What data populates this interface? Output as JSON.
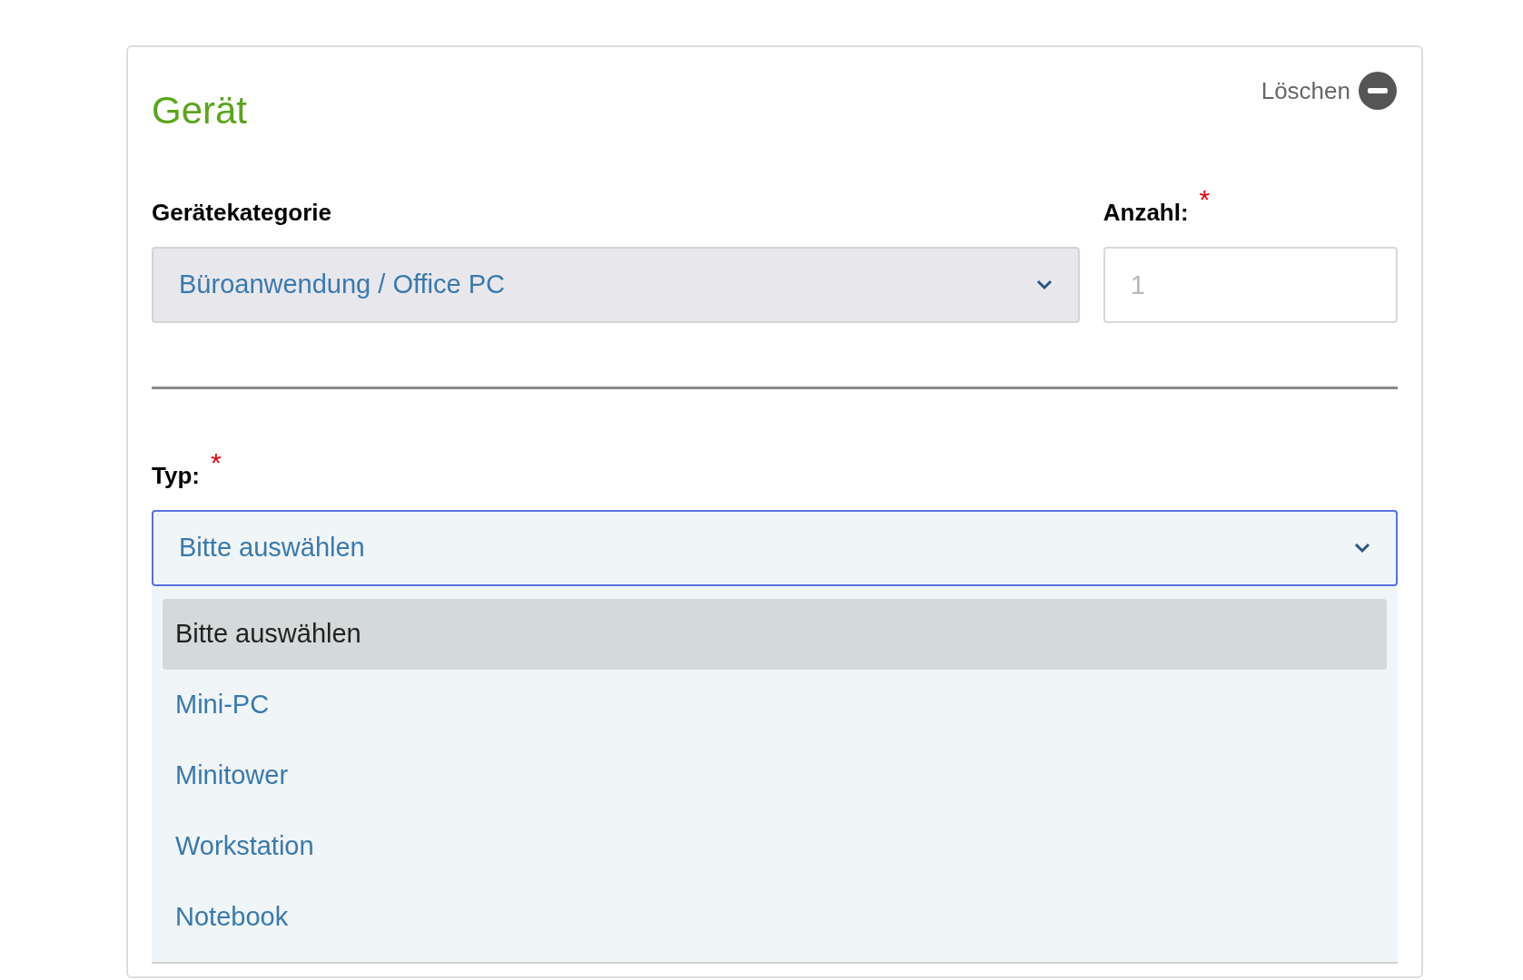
{
  "card": {
    "title": "Gerät",
    "delete_button": {
      "label": "Löschen"
    }
  },
  "category": {
    "label": "Gerätekategorie",
    "value": "Büroanwendung / Office PC",
    "disabled": true
  },
  "count": {
    "label": "Anzahl:",
    "required_mark": "*",
    "placeholder": "1"
  },
  "type": {
    "label": "Typ:",
    "required_mark": "*",
    "value": "Bitte auswählen",
    "focused": true,
    "options": [
      {
        "label": "Bitte auswählen",
        "selected": true
      },
      {
        "label": "Mini-PC",
        "selected": false
      },
      {
        "label": "Minitower",
        "selected": false
      },
      {
        "label": "Workstation",
        "selected": false
      },
      {
        "label": "Notebook",
        "selected": false
      }
    ]
  }
}
